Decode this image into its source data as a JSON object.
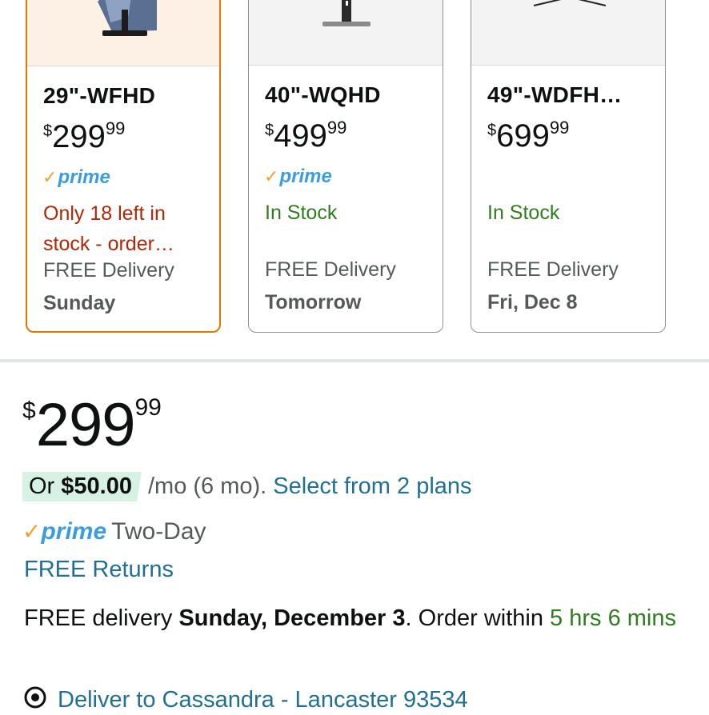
{
  "cards": [
    {
      "title": "29\"-WFHD",
      "price_symbol": "$",
      "price_whole": "299",
      "price_fraction": "99",
      "prime": "prime",
      "stock_text": "Only 18 left in stock - order…",
      "delivery_label": "FREE Delivery",
      "delivery_day": "Sunday",
      "selected": true
    },
    {
      "title": "40\"-WQHD",
      "price_symbol": "$",
      "price_whole": "499",
      "price_fraction": "99",
      "prime": "prime",
      "stock_text": "In Stock",
      "delivery_label": "FREE Delivery",
      "delivery_day": "Tomorrow",
      "selected": false
    },
    {
      "title": "49\"-WDFH…",
      "price_symbol": "$",
      "price_whole": "699",
      "price_fraction": "99",
      "stock_text": "In Stock",
      "delivery_label": "FREE Delivery",
      "delivery_day": "Fri, Dec 8",
      "selected": false
    }
  ],
  "main_price": {
    "symbol": "$",
    "whole": "299",
    "fraction": "99"
  },
  "financing": {
    "prefix": "Or",
    "amount": "$50.00",
    "term": "/mo (6 mo).",
    "link": "Select from 2 plans"
  },
  "prime_row": {
    "check": "✓",
    "word": "prime",
    "speed": "Two-Day"
  },
  "returns": "FREE Returns",
  "delivery": {
    "prefix": "FREE delivery",
    "date": "Sunday, December 3",
    "middle": ". Order within",
    "countdown": "5 hrs 6 mins"
  },
  "deliver_to": "Deliver to Cassandra - Lancaster 93534",
  "colors": {
    "selected_border": "#e77600",
    "prime_blue": "#3d9ddb",
    "prime_check": "#f0a32f",
    "low_stock": "#b12704",
    "in_stock": "#2f7d1e",
    "link": "#22708f",
    "financing_badge": "#d7f2e5"
  },
  "icons": {
    "prime_check": "check-icon",
    "location": "location-pin-icon"
  }
}
